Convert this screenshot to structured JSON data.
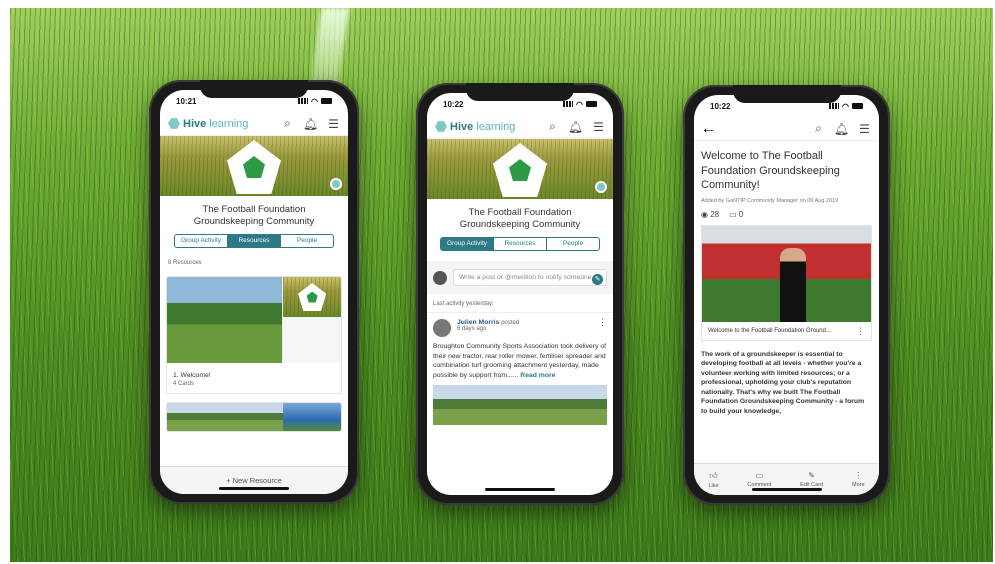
{
  "brand": {
    "logo_main": "Hive",
    "logo_sub": "learning",
    "accent": "#2b7a86"
  },
  "community_title_1": "The Football Foundation",
  "community_title_2": "Groundskeeping Community",
  "tabs": [
    "Group Activity",
    "Resources",
    "People"
  ],
  "phone1": {
    "time": "10:21",
    "resource_count": "8 Resources",
    "card_title": "1. Welcome!",
    "card_sub": "4 Cards",
    "new_resource": "+ New Resource"
  },
  "phone2": {
    "time": "10:22",
    "compose_placeholder": "Write a post or @mention to notify someone",
    "last_activity": "Last activity yesterday.",
    "author": "Julien Morris",
    "posted": "posted",
    "ago": "6 days ago",
    "post_text": "Broughton Community Sports Association took delivery of their new tractor, rear roller mower, fertiliser spreader and combination turf grooming attachment yesterday, made possible by support from......",
    "read_more": "Read more"
  },
  "phone3": {
    "time": "10:22",
    "article_title": "Welcome to The Football Foundation Groundskeeping Community!",
    "added_by": "Added by GaNTIP Community Manager on 06 Aug 2019",
    "views": "28",
    "comments": "0",
    "media_caption": "Welcome to the Football Foundation Ground...",
    "body": "The work of a groundskeeper is essential to developing football at all levels - whether you're a volunteer working with limited resources; or a professional, upholding your club's reputation nationally. That's why we built The Football Foundation Groundskeeping Community - a forum to build your knowledge,",
    "actions": [
      "Like",
      "Comment",
      "Edit Card",
      "More"
    ]
  }
}
